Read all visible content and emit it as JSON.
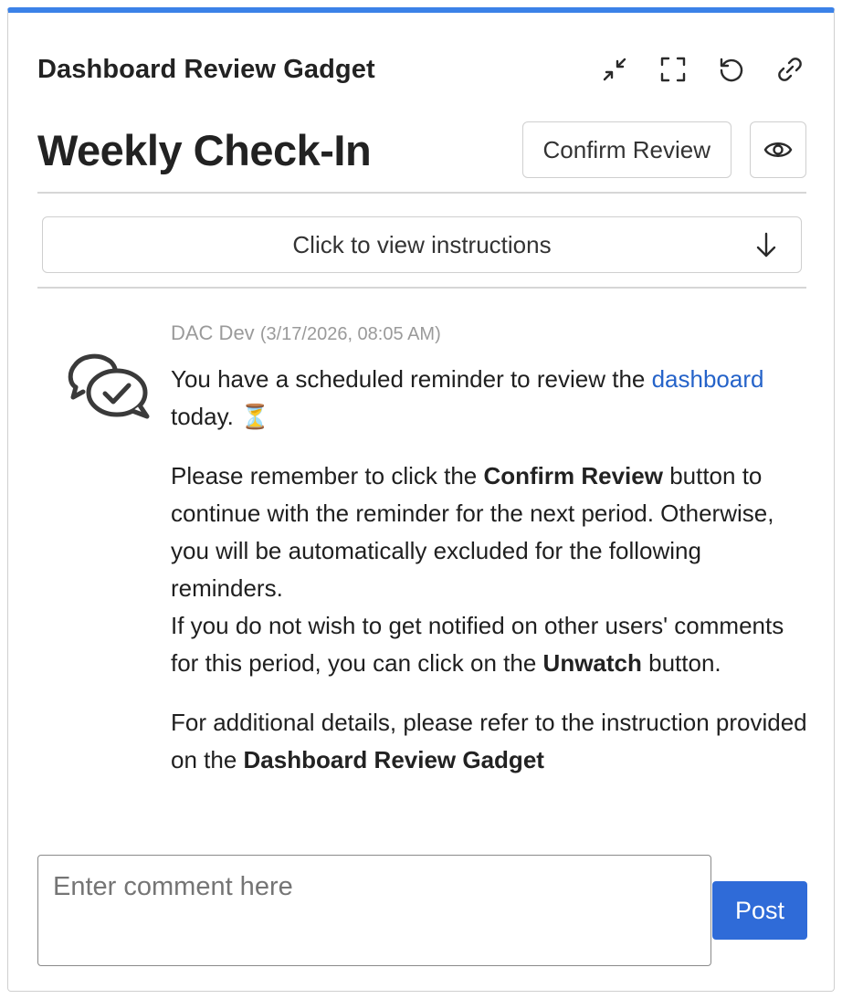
{
  "gadget": {
    "title": "Dashboard Review Gadget",
    "accent_color": "#3b82e8",
    "header_icons": [
      "collapse-icon",
      "fullscreen-icon",
      "refresh-icon",
      "link-icon"
    ]
  },
  "page": {
    "title": "Weekly Check-In",
    "confirm_button": "Confirm Review",
    "watch_icon": "eye-icon"
  },
  "instructions": {
    "label": "Click to view instructions",
    "icon": "arrow-down-icon"
  },
  "message": {
    "icon": "chat-check-icon",
    "author": "DAC Dev",
    "timestamp": "(3/17/2026, 08:05 AM)",
    "p1_before_link": "You have a scheduled reminder to review the ",
    "p1_link": "dashboard",
    "p1_after_link": " today. ⏳",
    "p2_a": "Please remember to click the ",
    "p2_bold1": "Confirm Review",
    "p2_b": " button to continue with the reminder for the next period. Otherwise, you will be automatically excluded for the following reminders.",
    "p2_c": "If you do not wish to get notified on other users' comments for this period, you can click on the ",
    "p2_bold2": "Unwatch",
    "p2_d": " button.",
    "p3_a": "For additional details, please refer to the instruction provided on the ",
    "p3_bold": "Dashboard Review Gadget",
    "link_color": "#2563c9"
  },
  "comment": {
    "placeholder": "Enter comment here",
    "value": "",
    "post_label": "Post",
    "post_color": "#2f6bd8"
  }
}
